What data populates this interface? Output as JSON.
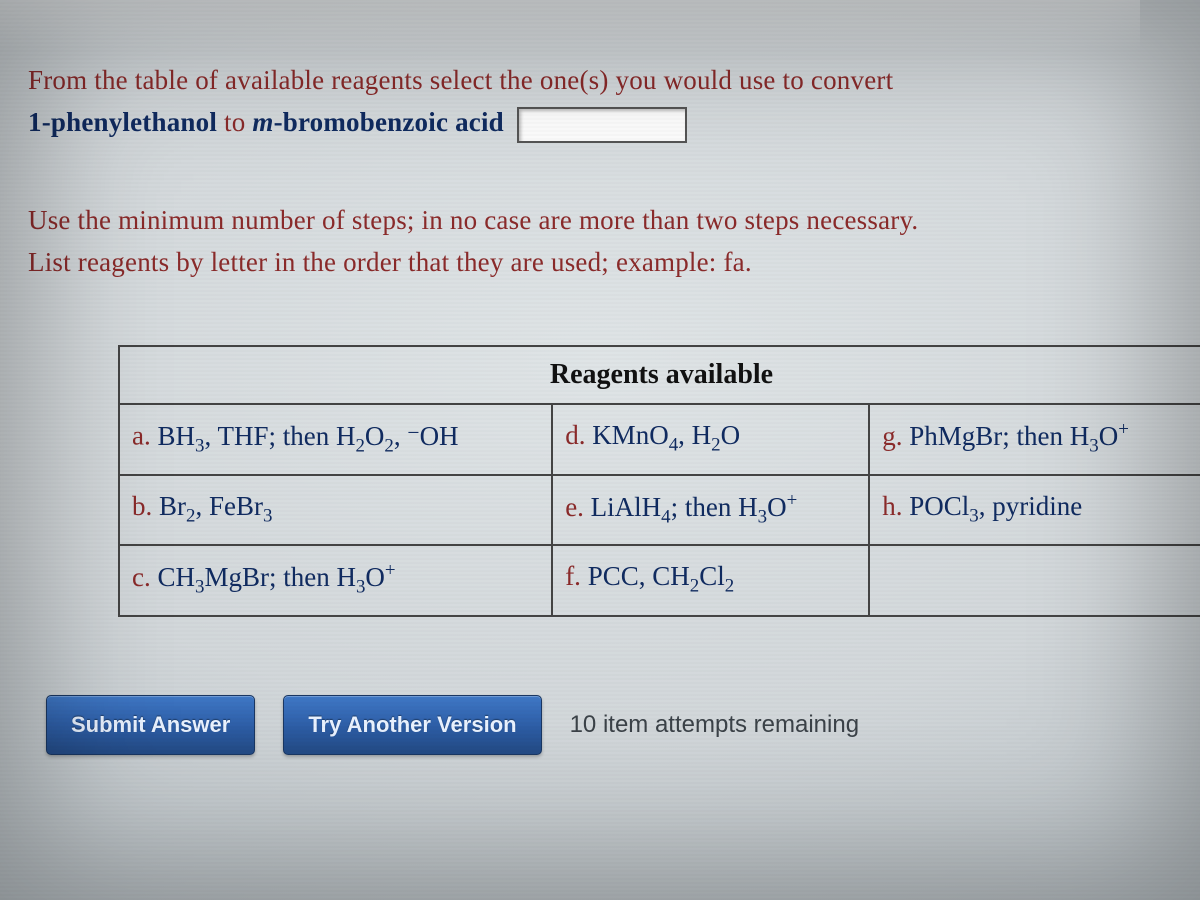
{
  "prompt": {
    "lead": "From the table of available reagents select the one(s) you would use to convert",
    "compound_from": "1-phenylethanol",
    "joiner": " to ",
    "compound_to_prefix": "m",
    "compound_to_suffix": "-bromobenzoic acid",
    "answer_value": ""
  },
  "instructions": {
    "line1": "Use the minimum number of steps; in no case are more than two steps necessary.",
    "line2": "List reagents by letter in the order that they are used; example: fa."
  },
  "table": {
    "header": "Reagents available",
    "cells": {
      "a_letter": "a.",
      "a_chem": "BH₃, THF; then H₂O₂, ⁻OH",
      "b_letter": "b.",
      "b_chem": "Br₂, FeBr₃",
      "c_letter": "c.",
      "c_chem": "CH₃MgBr; then H₃O⁺",
      "d_letter": "d.",
      "d_chem": "KMnO₄, H₂O",
      "e_letter": "e.",
      "e_chem": "LiAlH₄; then H₃O⁺",
      "f_letter": "f.",
      "f_chem": "PCC, CH₂Cl₂",
      "g_letter": "g.",
      "g_chem": "PhMgBr; then H₃O⁺",
      "h_letter": "h.",
      "h_chem": "POCl₃, pyridine"
    }
  },
  "controls": {
    "submit_label": "Submit Answer",
    "try_another_label": "Try Another Version",
    "attempts_text": "10 item attempts remaining"
  }
}
